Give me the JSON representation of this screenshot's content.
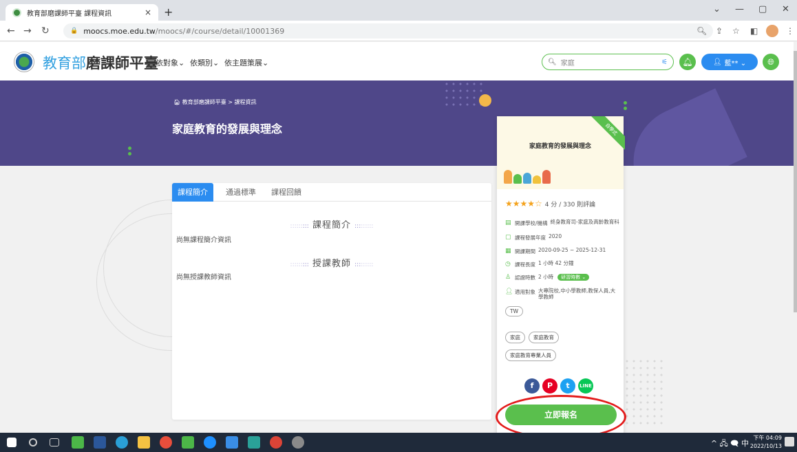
{
  "browser": {
    "tab_title": "教育部磨課師平臺 課程資訊",
    "tab_close": "×",
    "new_tab": "+",
    "url_host": "moocs.moe.edu.tw",
    "url_path": "/moocs/#/course/detail/10001369",
    "win_min": "—",
    "win_max": "▢",
    "win_close": "✕",
    "win_dropdown": "⌄"
  },
  "site": {
    "brand_part1": "教育部",
    "brand_part2": "磨課師平臺",
    "nav": [
      "依對象⌄",
      "依類別⌄",
      "依主題策展⌄"
    ],
    "search_placeholder": "家庭",
    "user_label": "藍**  ⌄"
  },
  "banner": {
    "breadcrumb": "教育部磨課師平臺 > 課程資訊",
    "course_title": "家庭教育的發展與理念"
  },
  "tabs": [
    "課程簡介",
    "通過標準",
    "課程回饋"
  ],
  "content": {
    "intro_heading": "課程簡介",
    "intro_text": "尚無課程簡介資訊",
    "teacher_heading": "授課教師",
    "teacher_text": "尚無授課教師資訊"
  },
  "side": {
    "cover_title": "家庭教育的發展與理念",
    "ribbon": "自學式",
    "rating_text": "4 分 / 330 則評論",
    "rating_value": 4,
    "rating_max": 5,
    "meta": [
      {
        "icon": "school-icon",
        "label": "開課學校/機構",
        "value": "終身教育司-家庭及高齡教育科"
      },
      {
        "icon": "bookmark-icon",
        "label": "課程發展年度",
        "value": "2020"
      },
      {
        "icon": "calendar-icon",
        "label": "開課期間",
        "value": "2020-09-25 ~ 2025-12-31"
      },
      {
        "icon": "clock-icon",
        "label": "課程長度",
        "value": "1 小時 42 分鐘"
      },
      {
        "icon": "award-icon",
        "label": "認證時數",
        "value": "2 小時"
      },
      {
        "icon": "person-icon",
        "label": "適用對象",
        "value": "大專院校,中小學教師,教保人員,大學教師"
      }
    ],
    "hours_button": "研習時數 ⌄",
    "lang_tag": "TW",
    "tags": [
      "家庭",
      "家庭教育",
      "家庭教育專業人員"
    ],
    "enroll": "立即報名"
  },
  "taskbar": {
    "tray": "^ 🖧 🗨 中",
    "time": "下午 04:09",
    "date": "2022/10/13"
  }
}
